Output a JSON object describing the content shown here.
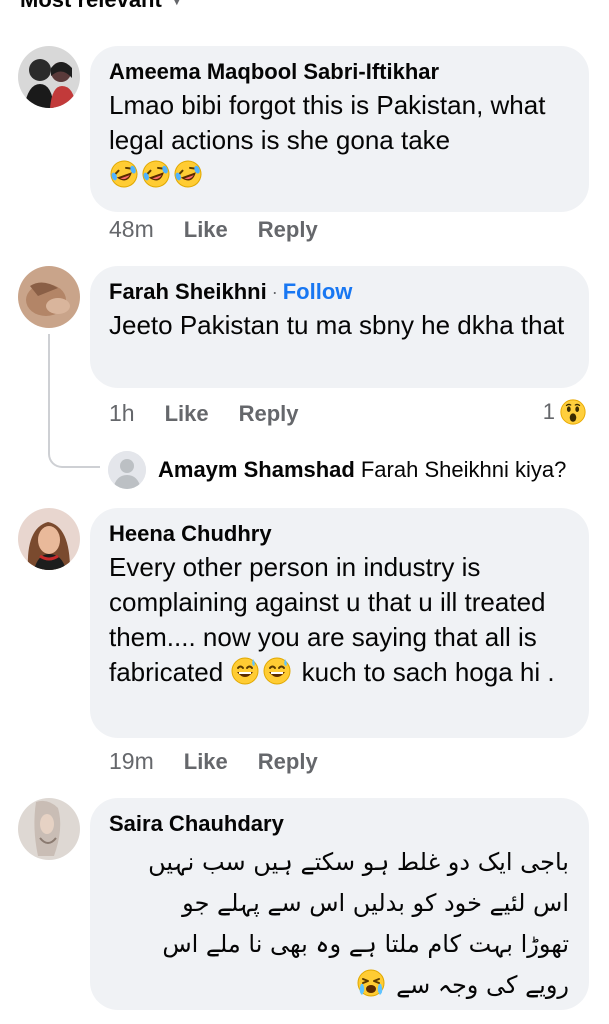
{
  "sort": {
    "label": "Most relevant"
  },
  "comments": [
    {
      "author": "Ameema Maqbool Sabri-Iftikhar",
      "text": "Lmao bibi forgot this is Pakistan, what legal actions is she gona take",
      "emojis": [
        "rofl-emoji",
        "rofl-emoji",
        "rofl-emoji"
      ],
      "time": "48m",
      "like": "Like",
      "reply": "Reply"
    },
    {
      "author": "Farah Sheikhni",
      "follow": "Follow",
      "text": "Jeeto Pakistan tu ma sbny he dkha that",
      "time": "1h",
      "like": "Like",
      "reply": "Reply",
      "reaction_count": "1",
      "reaction_icon": "wow-reaction-icon",
      "replies": [
        {
          "author": "Amaym Shamshad",
          "text": "Farah Sheikhni kiya?"
        }
      ]
    },
    {
      "author": "Heena Chudhry",
      "text_before": "Every other person in industry is complaining against u that u ill treated them.... now you are saying that all is fabricated",
      "emojis": [
        "sweat-smile-emoji",
        "sweat-smile-emoji"
      ],
      "text_after": "kuch to sach hoga hi .",
      "time": "19m",
      "like": "Like",
      "reply": "Reply"
    },
    {
      "author": "Saira Chauhdary",
      "lines": [
        "باجی ایک دو غلط ہو سکتے ہیں سب نہیں",
        "اس لئیے خود کو بدلیں اس سے پہلے جو",
        "تھوڑا بہت کام ملتا ہے وہ بھی نا ملے اس",
        "رویے کی وجہ سے"
      ],
      "emojis": [
        "crying-emoji"
      ]
    }
  ],
  "colors": {
    "bubble": "#f0f2f5",
    "meta": "#65676b",
    "link": "#1877f2",
    "text": "#050505"
  }
}
